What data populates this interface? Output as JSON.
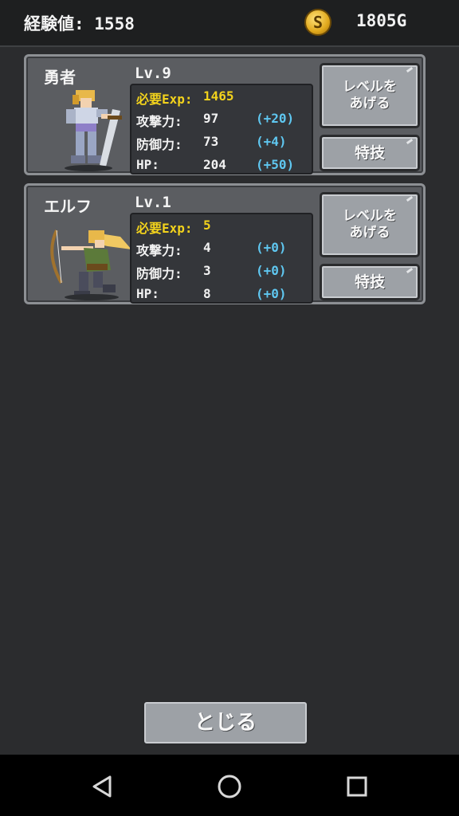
{
  "header": {
    "exp_text": "経験値: 1558",
    "coin_symbol": "S",
    "gold_text": "1805G"
  },
  "characters": [
    {
      "name": "勇者",
      "level": "Lv.9",
      "req_label": "必要Exp:",
      "req_value": "1465",
      "attack_label": "攻撃力:",
      "attack_value": "97",
      "attack_bonus": "(+20)",
      "defense_label": "防御力:",
      "defense_value": "73",
      "defense_bonus": "(+4)",
      "hp_label": "HP:",
      "hp_value": "204",
      "hp_bonus": "(+50)",
      "levelup_line1": "レベルを",
      "levelup_line2": "あげる",
      "skill_label": "特技"
    },
    {
      "name": "エルフ",
      "level": "Lv.1",
      "req_label": "必要Exp:",
      "req_value": "5",
      "attack_label": "攻撃力:",
      "attack_value": "4",
      "attack_bonus": "(+0)",
      "defense_label": "防御力:",
      "defense_value": "3",
      "defense_bonus": "(+0)",
      "hp_label": "HP:",
      "hp_value": "8",
      "hp_bonus": "(+0)",
      "levelup_line1": "レベルを",
      "levelup_line2": "あげる",
      "skill_label": "特技"
    }
  ],
  "close_label": "とじる",
  "navbar": {
    "icons": [
      "back-icon",
      "home-icon",
      "recents-icon"
    ]
  },
  "colors": {
    "accent_yellow": "#f2d21c",
    "bonus_blue": "#5fc7f0",
    "coin_gold": "#e0a81c"
  }
}
